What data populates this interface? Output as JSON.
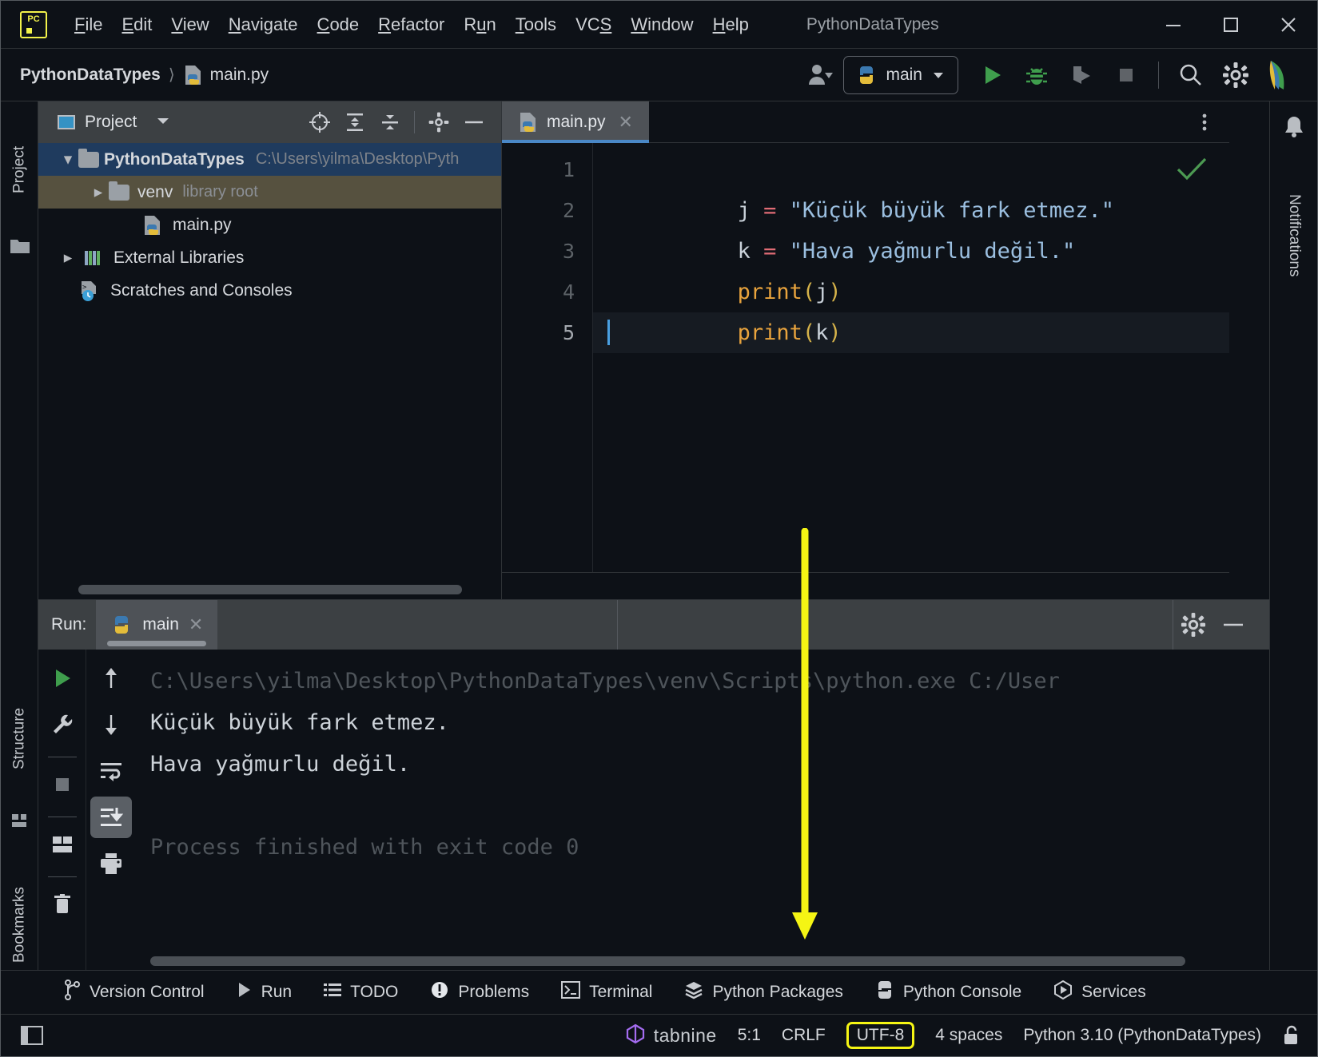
{
  "window": {
    "title": "PythonDataTypes",
    "minimize_label": "minimize-window",
    "maximize_label": "maximize-window",
    "close_label": "close-window"
  },
  "menubar": {
    "items": [
      {
        "label": "File",
        "mnemonic": "F"
      },
      {
        "label": "Edit",
        "mnemonic": "E"
      },
      {
        "label": "View",
        "mnemonic": "V"
      },
      {
        "label": "Navigate",
        "mnemonic": "N"
      },
      {
        "label": "Code",
        "mnemonic": "C"
      },
      {
        "label": "Refactor",
        "mnemonic": "R"
      },
      {
        "label": "Run",
        "mnemonic": "u"
      },
      {
        "label": "Tools",
        "mnemonic": "T"
      },
      {
        "label": "VCS",
        "mnemonic": "S"
      },
      {
        "label": "Window",
        "mnemonic": "W"
      },
      {
        "label": "Help",
        "mnemonic": "H"
      }
    ]
  },
  "navbar": {
    "breadcrumb": [
      "PythonDataTypes",
      "main.py"
    ],
    "run_config": "main",
    "icons": [
      "user-avatar-icon",
      "run-icon",
      "debug-icon",
      "run-coverage-icon",
      "stop-icon",
      "search-icon",
      "settings-icon",
      "ide-help-icon"
    ]
  },
  "left_rail": {
    "items": [
      "Project",
      "Structure",
      "Bookmarks"
    ]
  },
  "right_rail": {
    "items": [
      "Notifications"
    ]
  },
  "project_panel": {
    "title": "Project",
    "toolbar_icons": [
      "locate-icon",
      "expand-all-icon",
      "collapse-all-icon",
      "settings-icon",
      "hide-icon"
    ],
    "tree": [
      {
        "label": "PythonDataTypes",
        "detail": "C:\\Users\\yilma\\Desktop\\Pyth",
        "kind": "project-root",
        "indent": 0,
        "expanded": true,
        "selected": true
      },
      {
        "label": "venv",
        "detail": "library root",
        "kind": "folder",
        "indent": 1,
        "expanded": false,
        "selected": false
      },
      {
        "label": "main.py",
        "detail": "",
        "kind": "python-file",
        "indent": 2,
        "expanded": null,
        "selected": false
      },
      {
        "label": "External Libraries",
        "detail": "",
        "kind": "libraries",
        "indent": 0,
        "expanded": false,
        "selected": false
      },
      {
        "label": "Scratches and Consoles",
        "detail": "",
        "kind": "scratches",
        "indent": 0,
        "expanded": null,
        "selected": false
      }
    ]
  },
  "editor": {
    "tabs": [
      {
        "label": "main.py",
        "active": true,
        "closable": true
      }
    ],
    "more_label": "more-options",
    "inspection_status": "ok-checkmark",
    "lines": [
      {
        "number": "1",
        "tokens": [
          {
            "t": "j ",
            "c": "c-var"
          },
          {
            "t": "= ",
            "c": "c-op"
          },
          {
            "t": "\"Küçük büyük fark etmez.\"",
            "c": "c-str"
          }
        ]
      },
      {
        "number": "2",
        "tokens": [
          {
            "t": "k ",
            "c": "c-var"
          },
          {
            "t": "= ",
            "c": "c-op"
          },
          {
            "t": "\"Hava yağmurlu değil.\"",
            "c": "c-str"
          }
        ]
      },
      {
        "number": "3",
        "tokens": [
          {
            "t": "print",
            "c": "c-fn"
          },
          {
            "t": "(",
            "c": "c-paren"
          },
          {
            "t": "j",
            "c": "c-var"
          },
          {
            "t": ")",
            "c": "c-paren"
          }
        ]
      },
      {
        "number": "4",
        "tokens": [
          {
            "t": "print",
            "c": "c-fn"
          },
          {
            "t": "(",
            "c": "c-paren"
          },
          {
            "t": "k",
            "c": "c-var"
          },
          {
            "t": ")",
            "c": "c-paren"
          }
        ]
      },
      {
        "number": "5",
        "tokens": [],
        "current": true
      }
    ]
  },
  "run_panel": {
    "label": "Run:",
    "tab": "main",
    "toolbar_left": [
      "rerun-icon",
      "wrench-icon",
      "stop-icon",
      "layout-icon",
      "trash-icon"
    ],
    "toolbar_right": [
      "up-arrow-icon",
      "down-arrow-icon",
      "soft-wrap-icon",
      "scroll-to-end-icon",
      "print-icon"
    ],
    "header_icons": [
      "settings-icon",
      "hide-icon"
    ],
    "console": [
      {
        "text": "C:\\Users\\yilma\\Desktop\\PythonDataTypes\\venv\\Scripts\\python.exe C:/User",
        "dim": true
      },
      {
        "text": "Küçük büyük fark etmez.",
        "dim": false
      },
      {
        "text": "Hava yağmurlu değil.",
        "dim": false
      },
      {
        "text": "",
        "dim": false
      },
      {
        "text": "Process finished with exit code 0",
        "dim": true
      }
    ]
  },
  "tool_window_bar": {
    "items": [
      {
        "label": "Version Control",
        "icon": "branch-icon"
      },
      {
        "label": "Run",
        "icon": "play-icon"
      },
      {
        "label": "TODO",
        "icon": "list-icon"
      },
      {
        "label": "Problems",
        "icon": "warning-icon"
      },
      {
        "label": "Terminal",
        "icon": "terminal-icon"
      },
      {
        "label": "Python Packages",
        "icon": "packages-icon"
      },
      {
        "label": "Python Console",
        "icon": "python-icon"
      },
      {
        "label": "Services",
        "icon": "services-icon"
      }
    ]
  },
  "status_bar": {
    "layout_icon": "layout-toggle-icon",
    "tabnine": "tabnine",
    "caret_position": "5:1",
    "line_separator": "CRLF",
    "encoding": "UTF-8",
    "indent": "4 spaces",
    "interpreter": "Python 3.10 (PythonDataTypes)",
    "lock_icon": "unlocked-icon"
  },
  "annotation": {
    "type": "arrow",
    "color": "#f5f514",
    "points_to": "Python Packages",
    "highlight": "UTF-8"
  },
  "colors": {
    "accent_blue": "#4a88c7",
    "selection_blue": "#1f3b5e",
    "annotation_yellow": "#f5f514",
    "bg": "#0d1117",
    "panel_bg": "#3c4043",
    "string_blue": "#9bbfe0",
    "keyword_orange": "#e8a33d",
    "operator_red": "#e06c75"
  }
}
